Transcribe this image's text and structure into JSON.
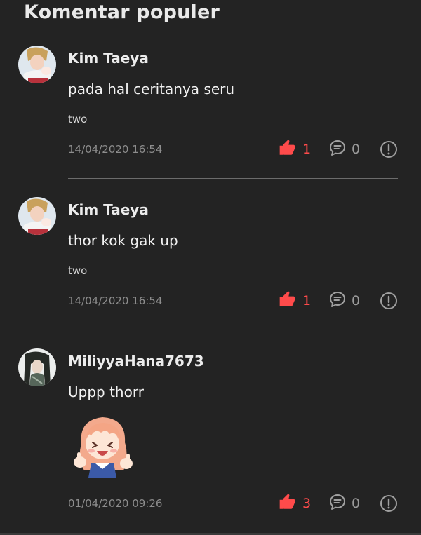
{
  "section": {
    "title": "Komentar populer"
  },
  "comments": [
    {
      "username": "Kim Taeya",
      "text": "pada hal ceritanya seru",
      "chapter": "two",
      "timestamp": "14/04/2020 16:54",
      "likes": "1",
      "replies": "0"
    },
    {
      "username": "Kim Taeya",
      "text": "thor kok gak up",
      "chapter": "two",
      "timestamp": "14/04/2020 16:54",
      "likes": "1",
      "replies": "0"
    },
    {
      "username": "MiliyyaHana7673",
      "text": "Uppp thorr",
      "sticker": "anime-girl-thumbs-up-sticker",
      "timestamp": "01/04/2020 09:26",
      "likes": "3",
      "replies": "0"
    }
  ],
  "icons": {
    "like": "thumbs-up-icon",
    "reply": "chat-bubble-icon",
    "report": "exclamation-circle-icon"
  },
  "colors": {
    "background": "#232323",
    "like_accent": "#ff4b4b",
    "muted_text": "#8d8d8d",
    "divider": "#6c6c6c"
  }
}
